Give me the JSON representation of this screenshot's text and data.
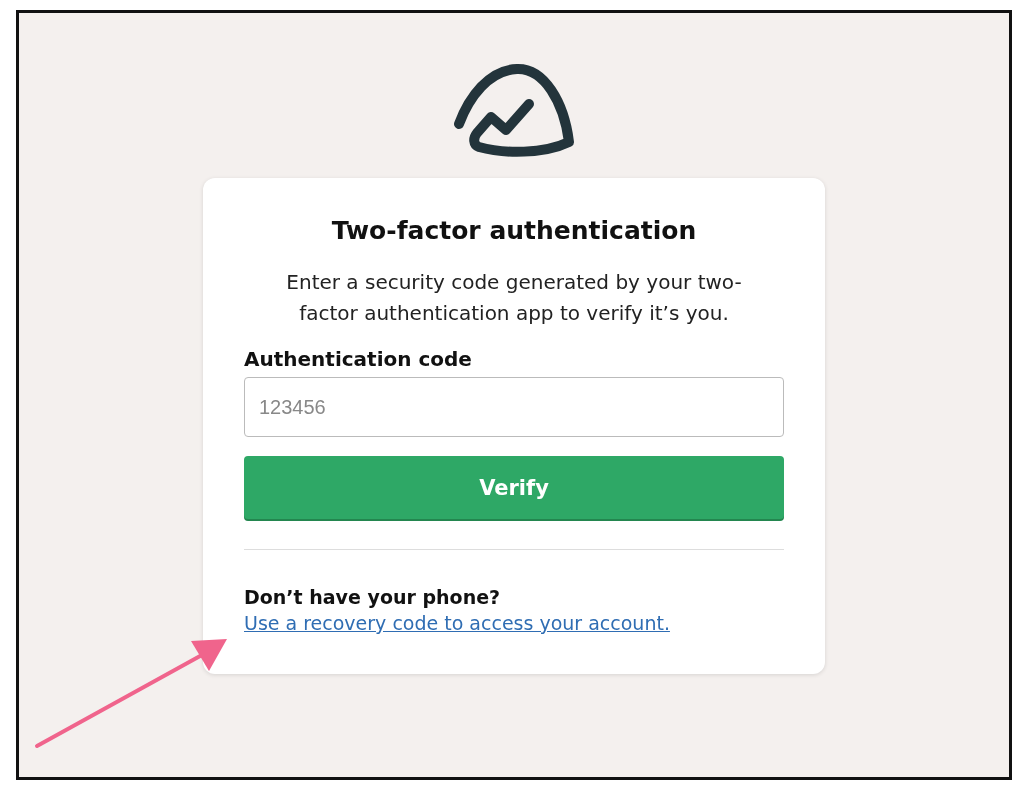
{
  "card": {
    "title": "Two-factor authentication",
    "description": "Enter a security code generated by your two-factor authentication app to verify it’s you.",
    "field": {
      "label": "Authentication code",
      "placeholder": "123456"
    },
    "button": "Verify",
    "help": {
      "heading": "Don’t have your phone?",
      "link": "Use a recovery code to access your account."
    }
  }
}
